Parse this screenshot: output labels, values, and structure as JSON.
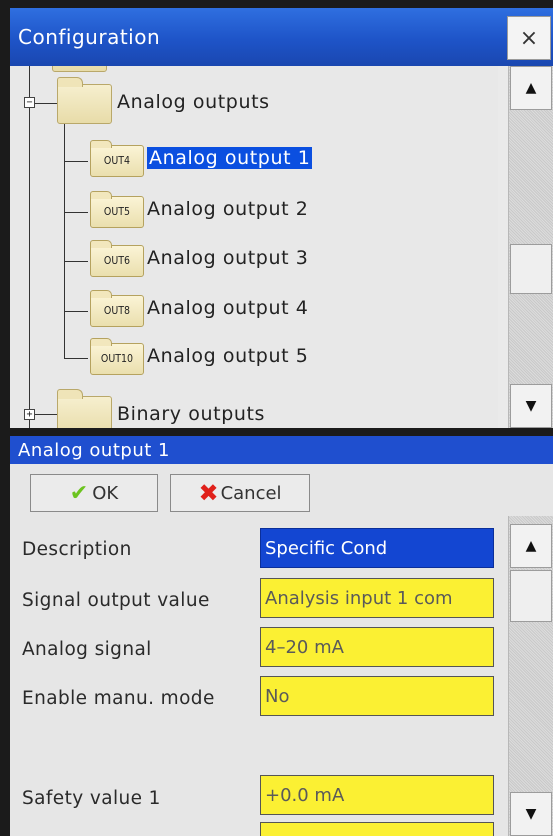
{
  "config_window": {
    "title": "Configuration",
    "close_label": "×",
    "tree": {
      "group": {
        "label": "Analog outputs",
        "expander": "−"
      },
      "items": [
        {
          "tag": "OUT4",
          "label": "Analog output 1",
          "selected": true
        },
        {
          "tag": "OUT5",
          "label": "Analog output 2",
          "selected": false
        },
        {
          "tag": "OUT6",
          "label": "Analog output 3",
          "selected": false
        },
        {
          "tag": "OUT8",
          "label": "Analog output 4",
          "selected": false
        },
        {
          "tag": "OUT10",
          "label": "Analog output 5",
          "selected": false
        }
      ],
      "next_group": {
        "label": "Binary outputs",
        "expander": "+"
      }
    },
    "scroll": {
      "up": "▲",
      "down": "▼"
    }
  },
  "detail_window": {
    "title": "Analog output 1",
    "ok_label": "OK",
    "cancel_label": "Cancel",
    "fields": [
      {
        "label": "Description",
        "value": "Specific Cond",
        "selected": true
      },
      {
        "label": "Signal output value",
        "value": "Analysis input 1 com",
        "selected": false
      },
      {
        "label": "Analog signal",
        "value": "4–20 mA",
        "selected": false
      },
      {
        "label": "Enable manu. mode",
        "value": "No",
        "selected": false
      },
      {
        "label": "Safety value 1",
        "value": "+0.0 mA",
        "selected": false
      }
    ],
    "scroll": {
      "up": "▲",
      "down": "▼"
    }
  },
  "colors": {
    "title_blue": "#1e54c8",
    "selection_blue": "#0b4fe0",
    "field_yellow": "#fbf033"
  }
}
